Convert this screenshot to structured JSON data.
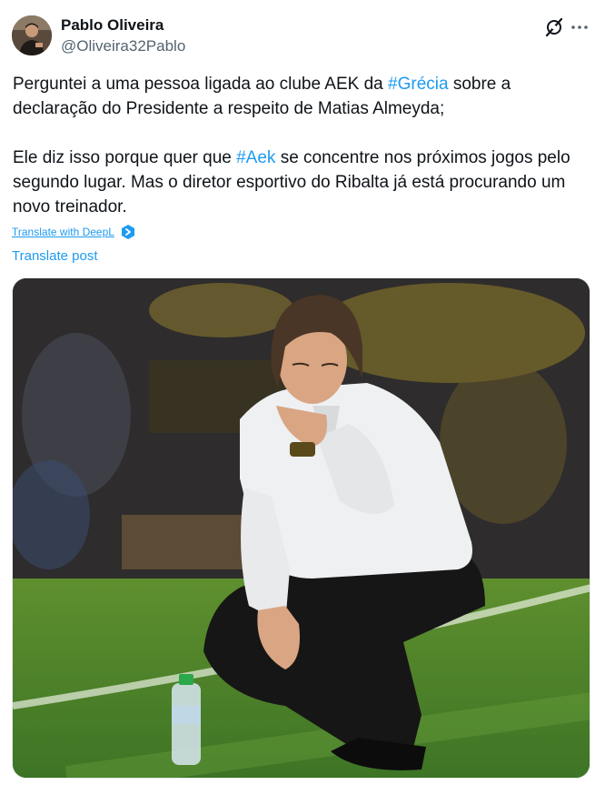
{
  "author": {
    "name": "Pablo Oliveira",
    "handle": "@Oliveira32Pablo"
  },
  "icons": {
    "grok": "grok-icon",
    "more": "more-icon",
    "deepl": "deepl-icon"
  },
  "tweet": {
    "line1_pre": "Perguntei a uma pessoa ligada ao clube AEK da ",
    "hashtag1": "#Grécia",
    "line1_post": " sobre a declaração do Presidente a respeito de Matias Almeyda;",
    "line2_pre": "Ele diz isso porque quer que ",
    "hashtag2": "#Aek",
    "line2_post": " se concentre nos próximos jogos pelo segundo lugar. Mas o diretor esportivo do Ribalta já está procurando um novo treinador."
  },
  "translate_deepl": "Translate with DeepL",
  "translate_post": "Translate post",
  "colors": {
    "link": "#1d9bf0",
    "text": "#0f1419",
    "secondary": "#536471"
  }
}
